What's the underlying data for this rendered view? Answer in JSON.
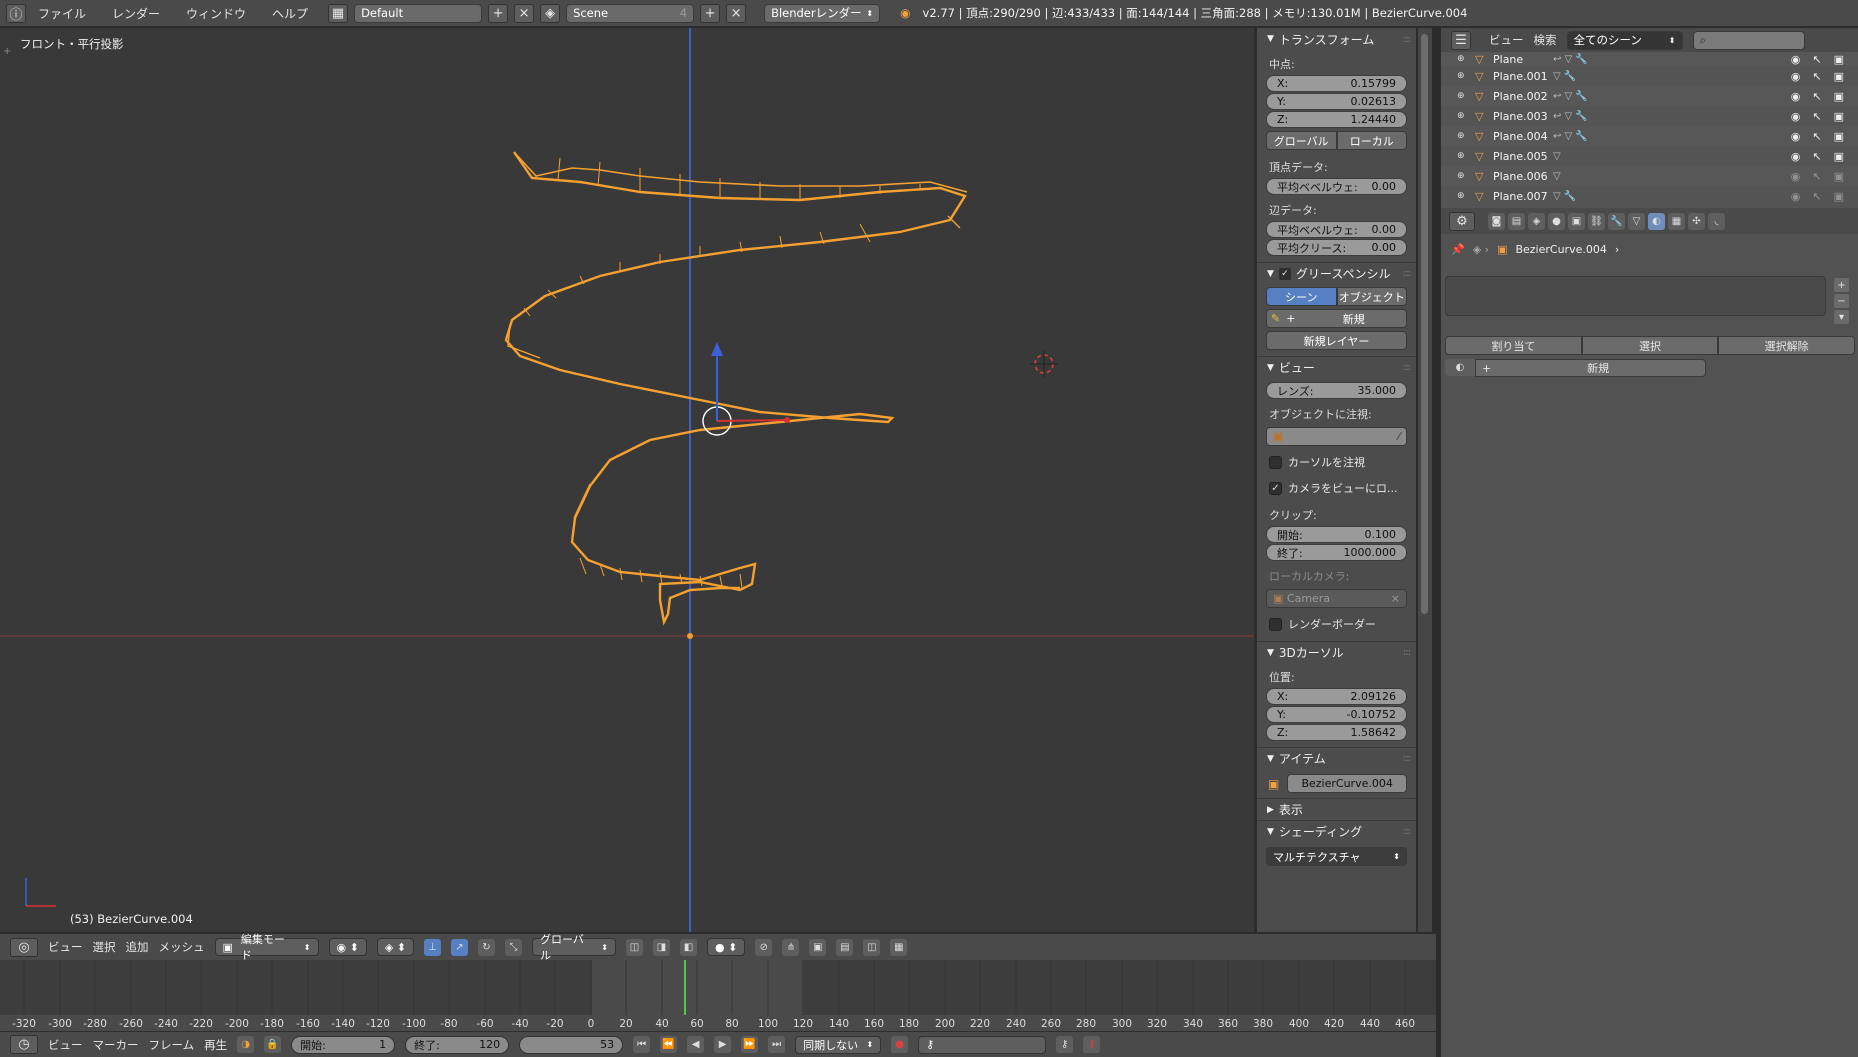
{
  "topbar": {
    "menus": [
      "ファイル",
      "レンダー",
      "ウィンドウ",
      "ヘルプ"
    ],
    "screen_layout": "Default",
    "scene": "Scene",
    "scene_users": "4",
    "render_engine": "Blenderレンダー",
    "info": "v2.77 | 頂点:290/290 | 辺:433/433 | 面:144/144 | 三角面:288 | メモリ:130.01M | BezierCurve.004"
  },
  "viewport": {
    "view_label": "フロント・平行投影",
    "object_label": "(53) BezierCurve.004"
  },
  "npanel": {
    "transform": {
      "title": "トランスフォーム",
      "median_label": "中点:",
      "x_label": "X:",
      "x": "0.15799",
      "y_label": "Y:",
      "y": "0.02613",
      "z_label": "Z:",
      "z": "1.24440",
      "global": "グローバル",
      "local": "ローカル",
      "vertex_data": "頂点データ:",
      "mean_bevel_label": "平均ベベルウェ:",
      "mean_bevel": "0.00",
      "edge_data": "辺データ:",
      "edge_bevel_label": "平均ベベルウェ:",
      "edge_bevel": "0.00",
      "crease_label": "平均クリース:",
      "crease": "0.00"
    },
    "grease_pencil": {
      "title": "グリースペンシル",
      "scene": "シーン",
      "object": "オブジェクト",
      "new": "新規",
      "new_layer": "新規レイヤー"
    },
    "view": {
      "title": "ビュー",
      "lens_label": "レンズ:",
      "lens": "35.000",
      "lock_object": "オブジェクトに注視:",
      "lock_cursor": "カーソルを注視",
      "lock_camera": "カメラをビューにロ...",
      "clip": "クリップ:",
      "start_label": "開始:",
      "start": "0.100",
      "end_label": "終了:",
      "end": "1000.000",
      "local_camera": "ローカルカメラ:",
      "camera": "Camera",
      "render_border": "レンダーボーダー"
    },
    "cursor3d": {
      "title": "3Dカーソル",
      "location": "位置:",
      "x_label": "X:",
      "x": "2.09126",
      "y_label": "Y:",
      "y": "-0.10752",
      "z_label": "Z:",
      "z": "1.58642"
    },
    "item": {
      "title": "アイテム",
      "name": "BezierCurve.004"
    },
    "display": {
      "title": "表示"
    },
    "shading": {
      "title": "シェーディング",
      "mode": "マルチテクスチャ"
    }
  },
  "outliner": {
    "view": "ビュー",
    "search": "検索",
    "filter": "全てのシーン",
    "rows": [
      {
        "name": "Plane",
        "mods": "↩ ▽ 🔧"
      },
      {
        "name": "Plane.001",
        "mods": "▽ 🔧"
      },
      {
        "name": "Plane.002",
        "mods": "↩ ▽ 🔧"
      },
      {
        "name": "Plane.003",
        "mods": "↩ ▽ 🔧"
      },
      {
        "name": "Plane.004",
        "mods": "↩ ▽ 🔧"
      },
      {
        "name": "Plane.005",
        "mods": "▽"
      },
      {
        "name": "Plane.006",
        "mods": "▽"
      },
      {
        "name": "Plane.007",
        "mods": "▽ 🔧"
      }
    ]
  },
  "properties": {
    "breadcrumb": "BezierCurve.004",
    "assign": "割り当て",
    "select": "選択",
    "deselect": "選択解除",
    "new": "新規"
  },
  "view_header": {
    "menus": [
      "ビュー",
      "選択",
      "追加",
      "メッシュ"
    ],
    "mode": "編集モード",
    "orientation": "グローバル"
  },
  "timeline": {
    "ruler": [
      "-320",
      "-300",
      "-280",
      "-260",
      "-240",
      "-220",
      "-200",
      "-180",
      "-160",
      "-140",
      "-120",
      "-100",
      "-80",
      "-60",
      "-40",
      "-20",
      "0",
      "20",
      "40",
      "60",
      "80",
      "100",
      "120",
      "140",
      "160",
      "180",
      "200",
      "220",
      "240",
      "260",
      "280",
      "300",
      "320",
      "340",
      "360",
      "380",
      "400",
      "420",
      "440",
      "460"
    ],
    "menus": [
      "ビュー",
      "マーカー",
      "フレーム",
      "再生"
    ],
    "start_label": "開始:",
    "start": "1",
    "end_label": "終了:",
    "end": "120",
    "current": "53",
    "sync": "同期しない"
  },
  "colors": {
    "accent": "#5680c2",
    "selection": "#f0a030",
    "viewport_bg": "#393939"
  }
}
